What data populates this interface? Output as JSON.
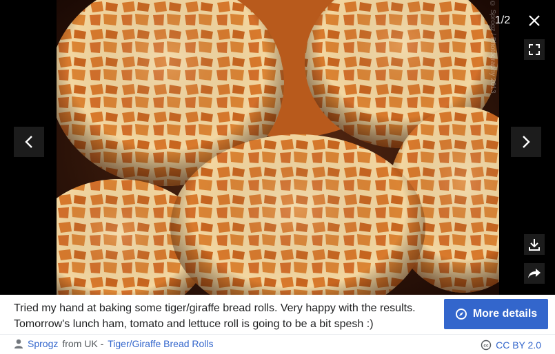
{
  "viewer": {
    "counter": "1/2",
    "watermark": "© Sprogz / Photography 2013",
    "photo_alt": "Tiger/Giraffe bread rolls"
  },
  "caption": {
    "text": "Tried my hand at baking some tiger/giraffe bread rolls. Very happy with the results. Tomorrow's lunch ham, tomato and lettuce roll is going to be a bit spesh :)"
  },
  "buttons": {
    "more_details": "More details"
  },
  "attribution": {
    "author": "Sprogz",
    "from": "from UK -",
    "title": "Tiger/Giraffe Bread Rolls",
    "license": "CC BY 2.0"
  },
  "icons": [
    "close-icon",
    "fullscreen-icon",
    "download-icon",
    "share-icon",
    "chevron-left-icon",
    "chevron-right-icon",
    "compass-icon",
    "user-icon",
    "cc-icon"
  ],
  "colors": {
    "accent": "#3366cc",
    "viewer_bg": "#000000",
    "crust": "#d2742a",
    "crackle": "#f4d9a0"
  }
}
